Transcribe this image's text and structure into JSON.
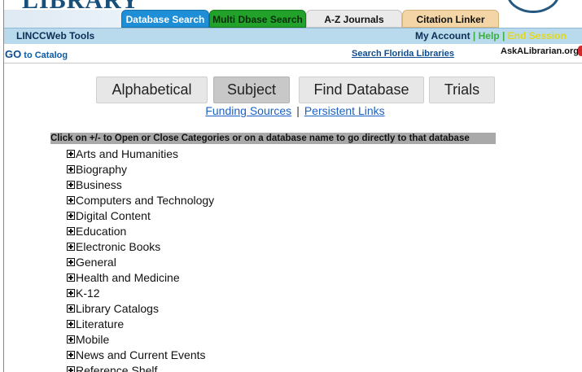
{
  "header": {
    "logo_text": "LIBRARY",
    "tabs": [
      {
        "label": "Database Search"
      },
      {
        "label": "Multi Dbase Search"
      },
      {
        "label": "A-Z Journals"
      },
      {
        "label": "Citation Linker"
      }
    ]
  },
  "toolbar": {
    "title": "LINCCWeb Tools",
    "my_account": "My Account",
    "separator": "|",
    "help": "Help",
    "end_session": "End Session"
  },
  "links_bar": {
    "go_prefix": "GO",
    "go_suffix": " to Catalog",
    "search_florida": "Search Florida Libraries",
    "ask_librarian": "AskALibrarian.org"
  },
  "browse_buttons": [
    {
      "label": "Alphabetical",
      "selected": false
    },
    {
      "label": "Subject",
      "selected": true
    },
    {
      "label": "Find Database",
      "selected": false
    },
    {
      "label": "Trials",
      "selected": false
    }
  ],
  "sub_links": {
    "funding": "Funding Sources",
    "separator": "|",
    "persistent": "Persistent Links"
  },
  "instruction": "Click on +/- to Open or Close Categories or on a database name to go directly to that database",
  "categories": [
    "Arts and Humanities",
    "Biography",
    "Business",
    "Computers and Technology",
    "Digital Content",
    "Education",
    "Electronic Books",
    "General",
    "Health and Medicine",
    "K-12",
    "Library Catalogs",
    "Literature",
    "Mobile",
    "News and Current Events",
    "Reference Shelf"
  ],
  "colors": {
    "tab_database_search": "#1e8ed6",
    "tab_multi_dbase": "#22a22a",
    "tab_az_journals": "#eaeaea",
    "tab_citation_linker": "#f4d6a6",
    "toolbar_bg": "#b9d9ec",
    "help_link": "#3bb03b",
    "end_session_link": "#e2d81c",
    "link_blue": "#1a62c4"
  },
  "icons": {
    "category_toggle": "plus-box-icon"
  }
}
